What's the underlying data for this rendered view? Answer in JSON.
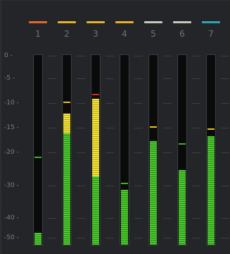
{
  "meter_panel": {
    "scale_labels": [
      "0",
      "-5",
      "-10",
      "-15",
      "-20",
      "-30",
      "-40",
      "-50"
    ],
    "channels": [
      {
        "number": "1",
        "tag_color": "#e3692a",
        "level_db": -47,
        "peak_db": -21,
        "yellow_top_db": null,
        "peak_color": "#3db324"
      },
      {
        "number": "2",
        "tag_color": "#e8b128",
        "level_db": -16,
        "peak_db": -9.5,
        "yellow_top_db": -12,
        "peak_color": "#e8c21e"
      },
      {
        "number": "3",
        "tag_color": "#e8b128",
        "level_db": -27,
        "peak_db": -8,
        "yellow_top_db": -9,
        "peak_color": "#d42a2a"
      },
      {
        "number": "4",
        "tag_color": "#e8b128",
        "level_db": -31,
        "peak_db": -29,
        "yellow_top_db": null,
        "peak_color": "#3db324"
      },
      {
        "number": "5",
        "tag_color": "#c9c6bd",
        "level_db": -17.5,
        "peak_db": -14.5,
        "yellow_top_db": null,
        "peak_color": "#e8c21e"
      },
      {
        "number": "6",
        "tag_color": "#c9c6bd",
        "level_db": -25,
        "peak_db": -18,
        "yellow_top_db": null,
        "peak_color": "#3db324"
      },
      {
        "number": "7",
        "tag_color": "#2aa8b5",
        "level_db": -16.5,
        "peak_db": -15,
        "yellow_top_db": null,
        "peak_color": "#e8c21e"
      }
    ]
  }
}
